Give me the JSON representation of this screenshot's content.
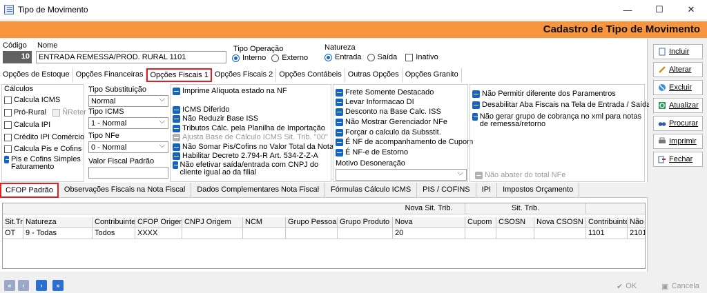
{
  "window": {
    "title": "Tipo de Movimento",
    "min_glyph": "—",
    "max_glyph": "☐",
    "close_glyph": "✕"
  },
  "header": {
    "title": "Cadastro de Tipo de Movimento",
    "color": "#f7943e"
  },
  "form": {
    "codigo_label": "Código",
    "codigo_value": "10",
    "nome_label": "Nome",
    "nome_value": "ENTRADA REMESSA/PROD. RURAL 1101",
    "tipo_operacao_label": "Tipo Operação",
    "tipo_operacao_options": [
      "Interno",
      "Externo"
    ],
    "tipo_operacao_selected": "Interno",
    "natureza_label": "Natureza",
    "natureza_options": [
      "Entrada",
      "Saída"
    ],
    "natureza_selected": "Entrada",
    "inativo_label": "Inativo"
  },
  "sidebar": {
    "buttons": [
      {
        "label": "Incluir",
        "icon": "new-document-icon"
      },
      {
        "label": "Alterar",
        "icon": "edit-pencil-icon"
      },
      {
        "label": "Excluir",
        "icon": "delete-icon"
      },
      {
        "label": "Atualizar",
        "icon": "refresh-icon"
      },
      {
        "label": "Procurar",
        "icon": "binoculars-icon"
      },
      {
        "label": "Imprimir",
        "icon": "printer-icon"
      },
      {
        "label": "Fechar",
        "icon": "close-door-icon"
      }
    ]
  },
  "tabs_top": [
    "Opções de Estoque",
    "Opções Financeiras",
    "Opções Fiscais 1",
    "Opções Fiscais 2",
    "Opções Contábeis",
    "Outras Opções",
    "Opções Granito"
  ],
  "tabs_top_active": "Opções Fiscais 1",
  "calculos": {
    "label": "Cálculos",
    "items": [
      "Calcula ICMS",
      "Pró-Rural",
      "Calcula IPI",
      "Crédito IPI Comércio",
      "Calcula Pis e Cofins",
      "Pis e Cofins Simples Faturamento"
    ],
    "nreter_label": "ÑReter"
  },
  "selects": {
    "tipo_substituicao_label": "Tipo Substituição",
    "tipo_substituicao_value": "Normal",
    "tipo_icms_label": "Tipo ICMS",
    "tipo_icms_value": "1 - Normal",
    "tipo_nfe_label": "Tipo NFe",
    "tipo_nfe_value": "0 - Normal",
    "valor_fiscal_label": "Valor Fiscal Padrão"
  },
  "col3_options": [
    "Imprime Alíquota estado na NF",
    "ICMS Diferido",
    "Não Reduzir Base ISS",
    "Tributos Cálc. pela Planilha de Importação",
    "Ajusta Base de Cálculo ICMS Sit. Trib. \"00\"",
    "Não Somar Pis/Cofins no Valor Total da Nota",
    "Habilitar Decreto 2.794-R Art. 534-Z-Z-A",
    "Não efetivar saída/entrada com CNPJ do cliente igual ao da filial"
  ],
  "col4_options": [
    "Frete Somente Destacado",
    "Levar Informacao DI",
    "Desconto na Base Calc. ISS",
    "Não Mostrar Gerenciador NFe",
    "Forçar o calculo da Subsstit.",
    "É NF de acompanhamento de Cupom",
    "É NF-e de Estorno"
  ],
  "motivo_label": "Motivo Desoneração",
  "col5_options": [
    "Não Permitir diferente dos Paramentros",
    "Desabilitar Aba Fiscais na Tela de Entrada / Saída",
    "Não gerar grupo de cobrança no xml para notas de remessa/retorno"
  ],
  "nao_abater_label": "Não abater do total NFe",
  "tabs_bottom": [
    "CFOP Padrão",
    "Observações Fiscais na Nota Fiscal",
    "Dados Complementares Nota Fiscal",
    "Fórmulas Cálculo ICMS",
    "PIS / COFINS",
    "IPI",
    "Impostos Orçamento"
  ],
  "tabs_bottom_active": "CFOP Padrão",
  "grid": {
    "group_headers": [
      "Nova Sit. Trib.",
      "Sit. Trib."
    ],
    "columns": [
      "Sit.Tr",
      "Natureza",
      "Contribuinte",
      "CFOP Origem",
      "CNPJ Origem",
      "NCM",
      "Grupo Pessoa",
      "Grupo Produto",
      "Nova",
      "Cupom",
      "CSOSN",
      "Nova CSOSN",
      "Contribuinte",
      "Não"
    ],
    "rows": [
      [
        "OT",
        "9 - Todas",
        "Todos",
        "XXXX",
        "",
        "",
        "",
        "",
        "20",
        "",
        "",
        "",
        "1101",
        "2101"
      ]
    ]
  },
  "footer": {
    "ok_label": "OK",
    "cancela_label": "Cancela",
    "nav_icons": [
      "first-icon",
      "prev-icon",
      "next-icon",
      "last-icon"
    ]
  },
  "colors": {
    "accent_red": "#e02020",
    "check_blue": "#1565c0"
  }
}
